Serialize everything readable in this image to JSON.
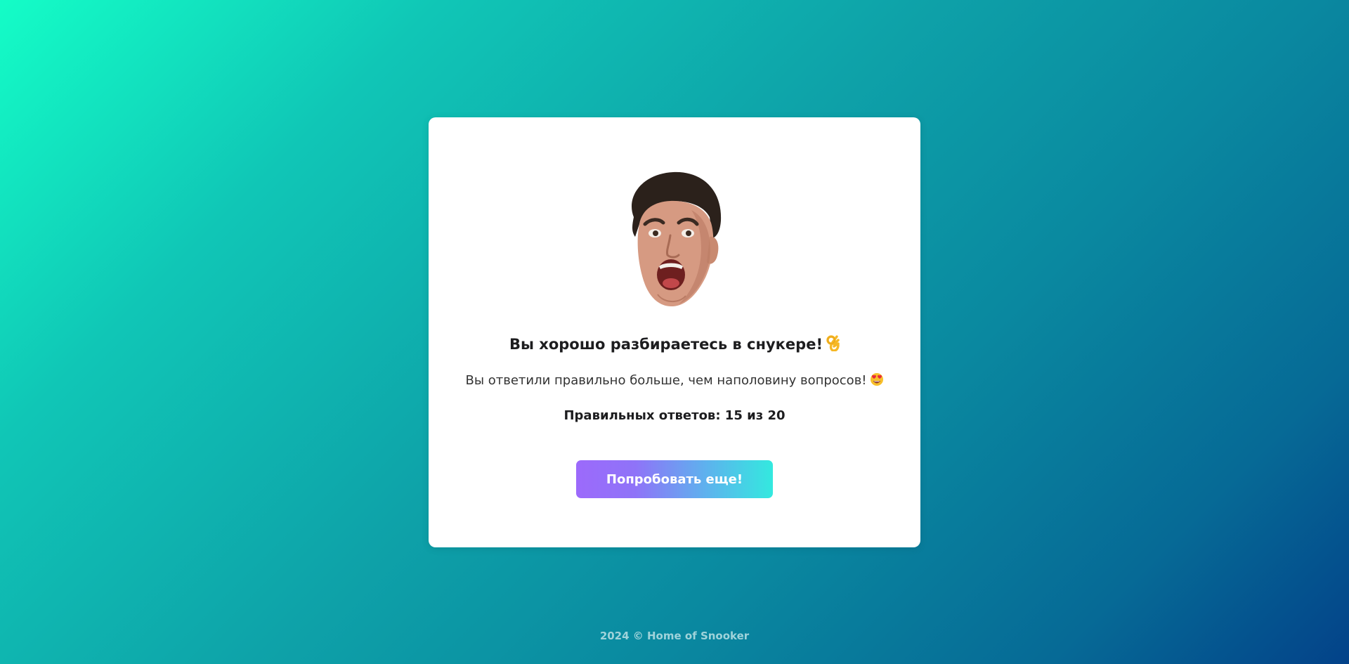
{
  "result": {
    "image_alt": "Ronnie O'Sullivan",
    "title": "Вы хорошо разбираетесь в снукере!",
    "title_emoji": "ok-hand-emoji",
    "message": "Вы ответили правильно больше, чем наполовину вопросов!",
    "message_emoji": "heart-eyes-emoji",
    "score_text": "Правильных ответов: 15 из 20"
  },
  "actions": {
    "retry_label": "Попробовать еще!"
  },
  "footer": {
    "text": "2024 © Home of Snooker"
  },
  "colors": {
    "background_start": "#14fdc7",
    "background_end": "#034289",
    "button_start": "#9c6afb",
    "button_end": "#33e9df",
    "card": "#ffffff"
  }
}
